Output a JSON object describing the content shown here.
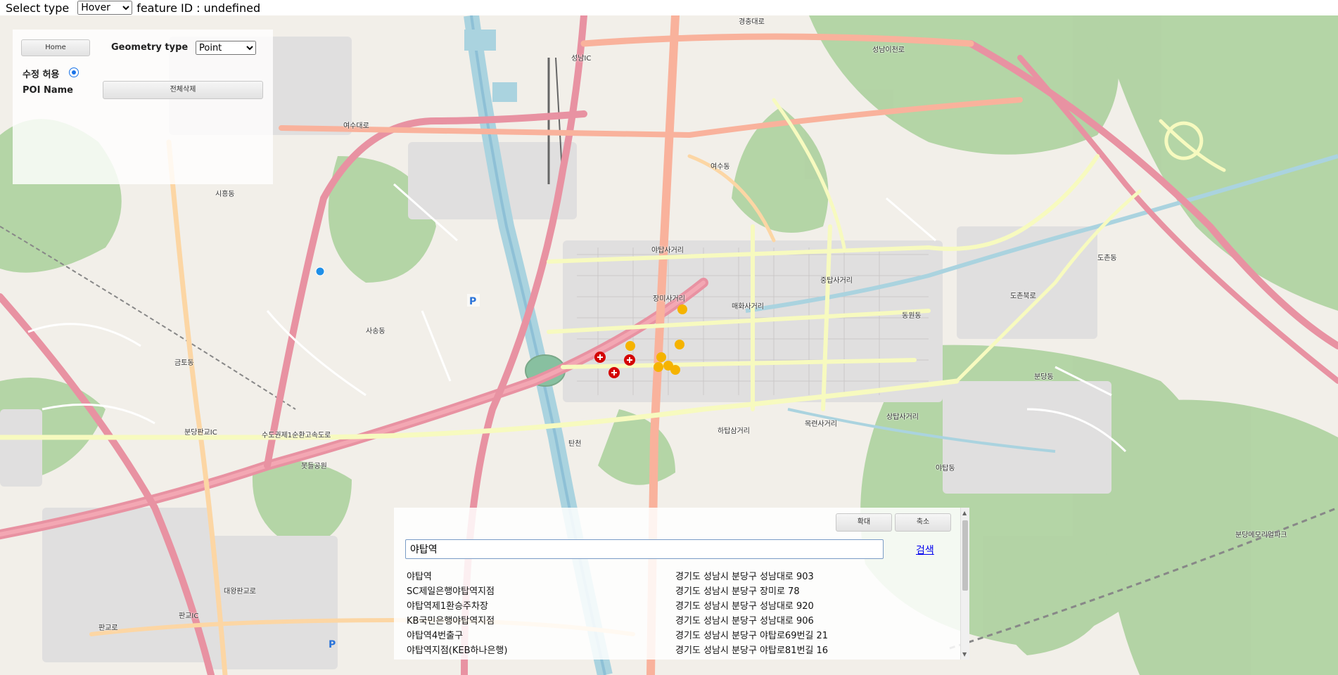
{
  "topbar": {
    "select_type_label": "Select type",
    "select_type_value": "Hover",
    "feature_id_text": "feature ID : undefined"
  },
  "control_panel": {
    "home_button": "Home",
    "geometry_type_label": "Geometry type",
    "geometry_type_value": "Point",
    "edit_allow_label": "수정 허용",
    "poi_name_label": "POI Name",
    "delete_all_button": "전체삭제"
  },
  "search_panel": {
    "zoom_in_button": "확대",
    "zoom_out_button": "축소",
    "query_value": "야탑역",
    "search_link": "검색",
    "results": [
      {
        "name": "야탑역",
        "address": "경기도 성남시 분당구 성남대로 903"
      },
      {
        "name": "SC제일은행야탑역지점",
        "address": "경기도 성남시 분당구 장미로 78"
      },
      {
        "name": "야탑역제1환승주차장",
        "address": "경기도 성남시 분당구 성남대로 920"
      },
      {
        "name": "KB국민은행야탑역지점",
        "address": "경기도 성남시 분당구 성남대로 906"
      },
      {
        "name": "야탑역4번출구",
        "address": "경기도 성남시 분당구 야탑로69번길 21"
      },
      {
        "name": "야탑역지점(KEB하나은행)",
        "address": "경기도 성남시 분당구 야탑로81번길 16"
      }
    ]
  },
  "map": {
    "labels": [
      "성남IC",
      "여수대로",
      "경충대로",
      "성남이천로",
      "야탑동",
      "야탑사거리",
      "장미사거리",
      "매화사거리",
      "중탑사거리",
      "동원동",
      "도촌동",
      "분당동",
      "수도권제1순환고속도로",
      "판교IC",
      "금토동",
      "대왕판교로",
      "판교로",
      "봇들공원",
      "탄천",
      "하탑삼거리",
      "목련사거리",
      "상탑사거리",
      "분당판교IC",
      "사송동",
      "시흥동",
      "여수동",
      "도촌북로",
      "분당메모리얼파크"
    ],
    "colors": {
      "background": "#f2efe9",
      "green": "#add19e",
      "motorway": "#e892a2",
      "trunk": "#f9b29c",
      "primary": "#fcd6a4",
      "secondary": "#f7fabf",
      "water": "#aad3df",
      "river": "#8ec0d6",
      "marker": "#f5b300",
      "point": "#1f8fe8",
      "hospital": "#d40000"
    }
  }
}
